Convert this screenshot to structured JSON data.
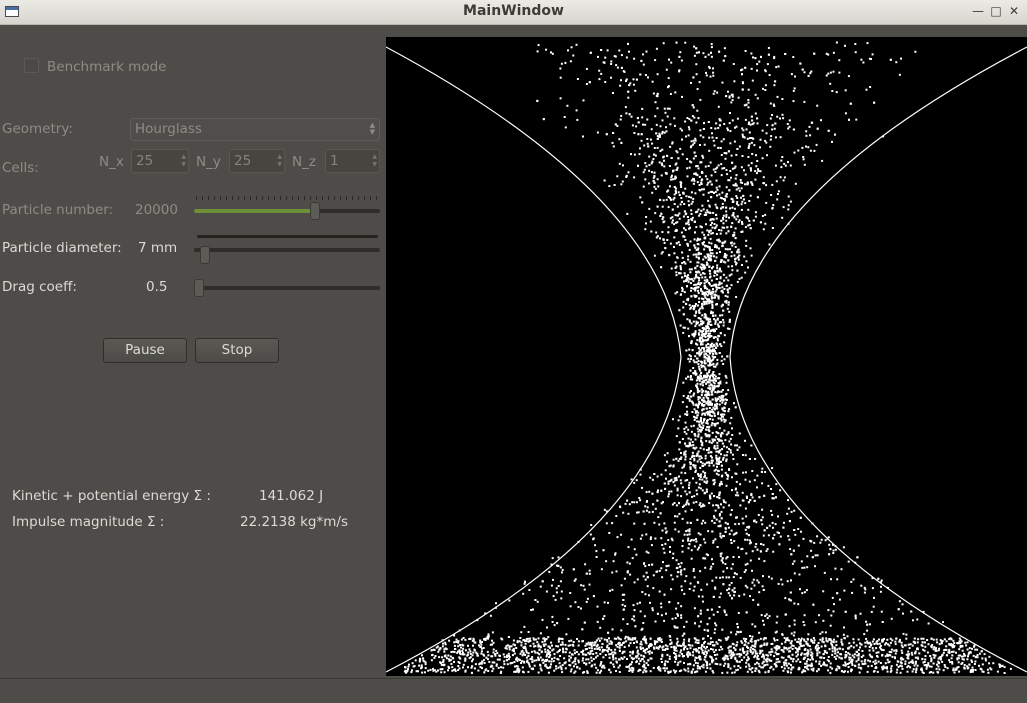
{
  "window": {
    "title": "MainWindow"
  },
  "benchmark": {
    "label": "Benchmark mode",
    "checked": false
  },
  "geometry": {
    "label": "Geometry:",
    "value": "Hourglass"
  },
  "cells": {
    "label": "Cells:",
    "nx_label": "N_x",
    "nx_value": "25",
    "ny_label": "N_y",
    "ny_value": "25",
    "nz_label": "N_z",
    "nz_value": "1"
  },
  "particle_number": {
    "label": "Particle number:",
    "value": "20000",
    "slider_fraction": 0.66
  },
  "particle_diameter": {
    "label": "Particle diameter:",
    "value": "7 mm",
    "slider_fraction": 0.02
  },
  "drag_coeff": {
    "label": "Drag coeff:",
    "value": "0.5",
    "slider_fraction": 0.0
  },
  "buttons": {
    "pause": "Pause",
    "stop": "Stop"
  },
  "stats": {
    "energy_label": "Kinetic + potential energy Σ :",
    "energy_value": "141.062 J",
    "impulse_label": "Impulse magnitude Σ :",
    "impulse_value": "22.2138 kg*m/s"
  },
  "icons": {
    "app": "window-icon",
    "minimize": "minimize-icon",
    "maximize": "maximize-icon",
    "close": "close-icon"
  },
  "colors": {
    "background": "#4d4c48",
    "slider_fill": "#6f8e3a",
    "simulation_bg": "#000000",
    "particles": "#ffffff"
  }
}
